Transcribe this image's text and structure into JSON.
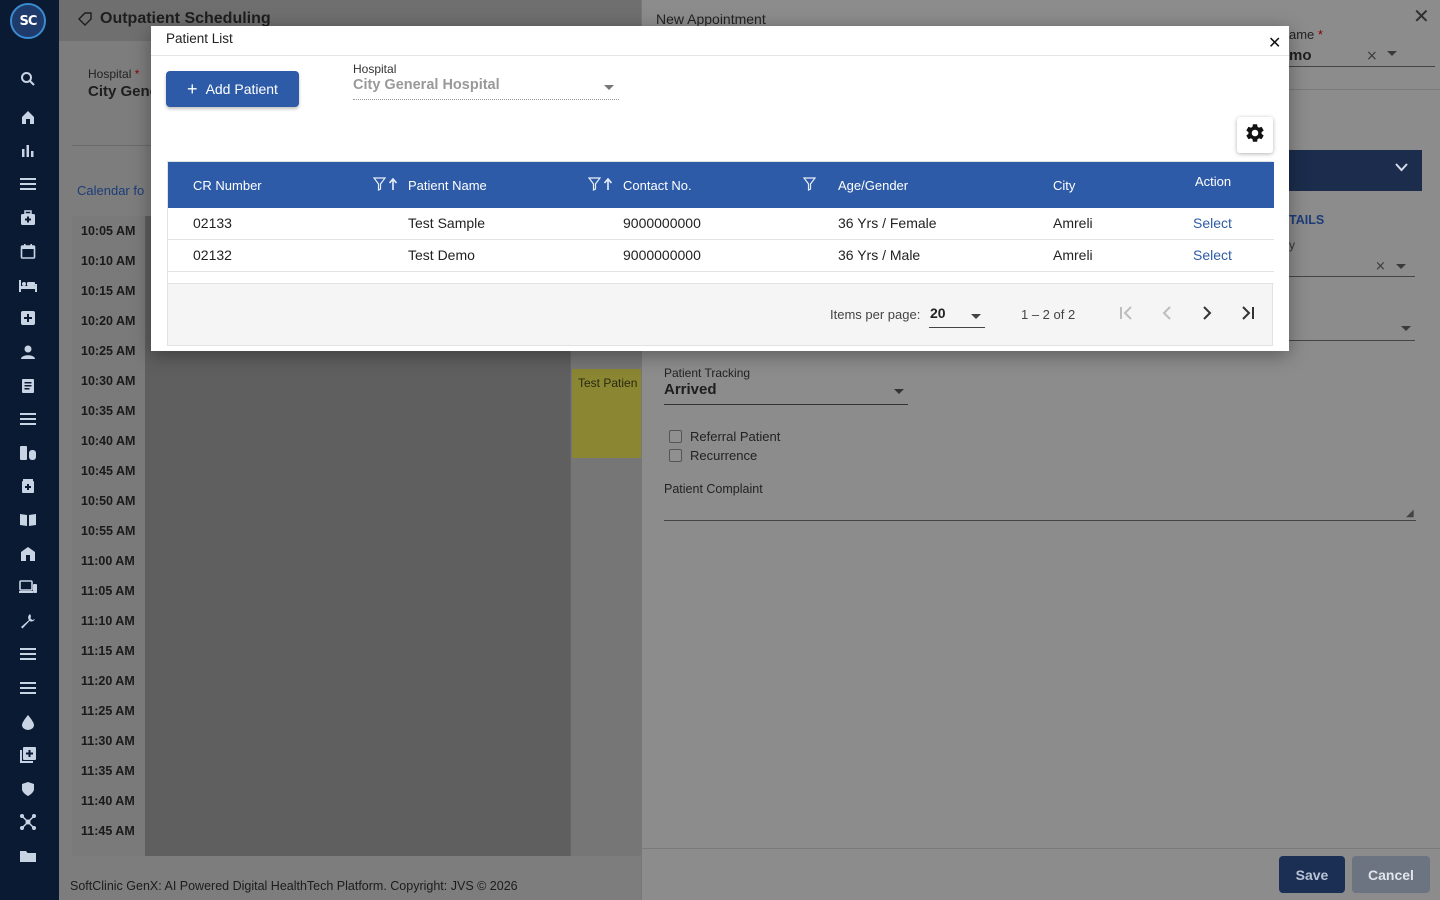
{
  "app": {
    "logo_text": "SC",
    "page_title": "Outpatient Scheduling",
    "footer": "SoftClinic GenX: AI Powered Digital HealthTech Platform. Copyright: JVS © 2026"
  },
  "sidebar": {
    "icons": [
      "search-icon",
      "home-icon",
      "bar-chart-icon",
      "menu-icon",
      "medical-bag-icon",
      "calendar-icon",
      "bed-icon",
      "hospital-plus-icon",
      "person-icon",
      "document-icon",
      "list-icon",
      "medicine-icon",
      "pharmacy-icon",
      "book-icon",
      "building-icon",
      "devices-icon",
      "wrench-icon",
      "lines-icon",
      "menu-icon-2",
      "drop-icon",
      "add-box-icon",
      "shield-icon",
      "network-icon",
      "folder-icon"
    ]
  },
  "background": {
    "hospital_label": "Hospital",
    "hospital_required": "*",
    "hospital_value": "City Gene",
    "calendar_label": "Calendar fo",
    "times": [
      "10:05 AM",
      "10:10 AM",
      "10:15 AM",
      "10:20 AM",
      "10:25 AM",
      "10:30 AM",
      "10:35 AM",
      "10:40 AM",
      "10:45 AM",
      "10:50 AM",
      "10:55 AM",
      "11:00 AM",
      "11:05 AM",
      "11:10 AM",
      "11:15 AM",
      "11:20 AM",
      "11:25 AM",
      "11:30 AM",
      "11:35 AM",
      "11:40 AM",
      "11:45 AM"
    ],
    "appointment_text": "Test Patien"
  },
  "drawer": {
    "title": "New Appointment",
    "patient_name_label": "ame",
    "patient_name_required": "*",
    "patient_name_value": "mo",
    "clear_glyph": "×",
    "details_tab": "TAILS",
    "small_label": "y",
    "patient_tracking_label": "Patient Tracking",
    "patient_tracking_value": "Arrived",
    "referral_label": "Referral Patient",
    "recurrence_label": "Recurrence",
    "complaint_label": "Patient Complaint",
    "save_label": "Save",
    "cancel_label": "Cancel"
  },
  "modal": {
    "title": "Patient List",
    "add_patient_label": "Add Patient",
    "hospital_label": "Hospital",
    "hospital_value": "City General Hospital",
    "columns": [
      "CR Number",
      "Patient Name",
      "Contact No.",
      "Age/Gender",
      "City",
      "Action"
    ],
    "rows": [
      {
        "cr": "02133",
        "name": "Test Sample",
        "contact": "9000000000",
        "age_gender": "36 Yrs / Female",
        "city": "Amreli",
        "action": "Select"
      },
      {
        "cr": "02132",
        "name": "Test Demo",
        "contact": "9000000000",
        "age_gender": "36 Yrs / Male",
        "city": "Amreli",
        "action": "Select"
      }
    ],
    "paginator": {
      "items_per_page_label": "Items per page:",
      "items_per_page_value": "20",
      "range_label": "1 – 2 of 2"
    }
  },
  "colors": {
    "primary": "#2d5ba7",
    "sidebar": "#0b1a33",
    "link": "#2d5ba7"
  }
}
